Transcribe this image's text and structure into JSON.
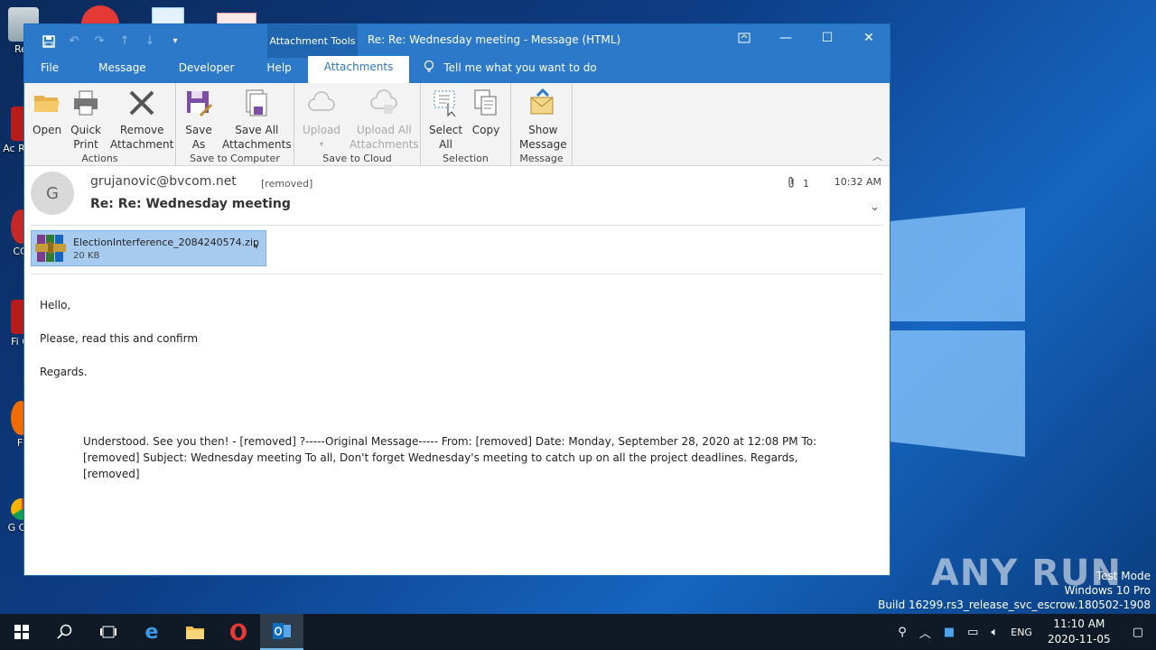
{
  "desktop": {
    "icons": [
      {
        "label": "Rec"
      },
      {
        "label": "Ac Rea"
      },
      {
        "label": "CC"
      },
      {
        "label": "Fi C"
      },
      {
        "label": "F"
      },
      {
        "label": "G Ch"
      }
    ],
    "watermark": "ANY RUN",
    "test_mode": {
      "line1": "Test Mode",
      "line2": "Windows 10 Pro",
      "line3": "Build 16299.rs3_release_svc_escrow.180502-1908"
    }
  },
  "window": {
    "context_tab": "Attachment Tools",
    "title": "Re: Re: Wednesday meeting  -  Message (HTML)",
    "tabs": [
      {
        "label": "File"
      },
      {
        "label": "Message"
      },
      {
        "label": "Developer"
      },
      {
        "label": "Help"
      },
      {
        "label": "Attachments"
      }
    ],
    "tell_me": "Tell me what you want to do",
    "groups": [
      {
        "label": "Actions",
        "buttons": [
          "Open",
          "Quick\nPrint",
          "Remove\nAttachment"
        ]
      },
      {
        "label": "Save to Computer",
        "buttons": [
          "Save\nAs",
          "Save All\nAttachments"
        ]
      },
      {
        "label": "Save to Cloud",
        "buttons": [
          "Upload",
          "Upload All\nAttachments"
        ]
      },
      {
        "label": "Selection",
        "buttons": [
          "Select\nAll",
          "Copy"
        ]
      },
      {
        "label": "Message",
        "buttons": [
          "Show\nMessage"
        ]
      }
    ]
  },
  "message": {
    "avatar_letter": "G",
    "sender": "grujanovic@bvcom.net",
    "to": "[removed]",
    "subject": "Re: Re: Wednesday meeting",
    "attachment_count": "1",
    "time": "10:32 AM",
    "attachment": {
      "name": "ElectionInterference_2084240574.zip",
      "size": "20 KB"
    },
    "body": [
      "Hello,",
      "Please, read this and confirm",
      "Regards."
    ],
    "quoted": "Understood. See you then! - [removed] ?-----Original Message----- From: [removed] Date: Monday, September 28, 2020  at 12:08 PM To: [removed] Subject: Wednesday meeting To all, Don't forget Wednesday's meeting to catch up on all the project deadlines. Regards, [removed]"
  },
  "taskbar": {
    "lang": "ENG",
    "time": "11:10 AM",
    "date": "2020-11-05"
  }
}
